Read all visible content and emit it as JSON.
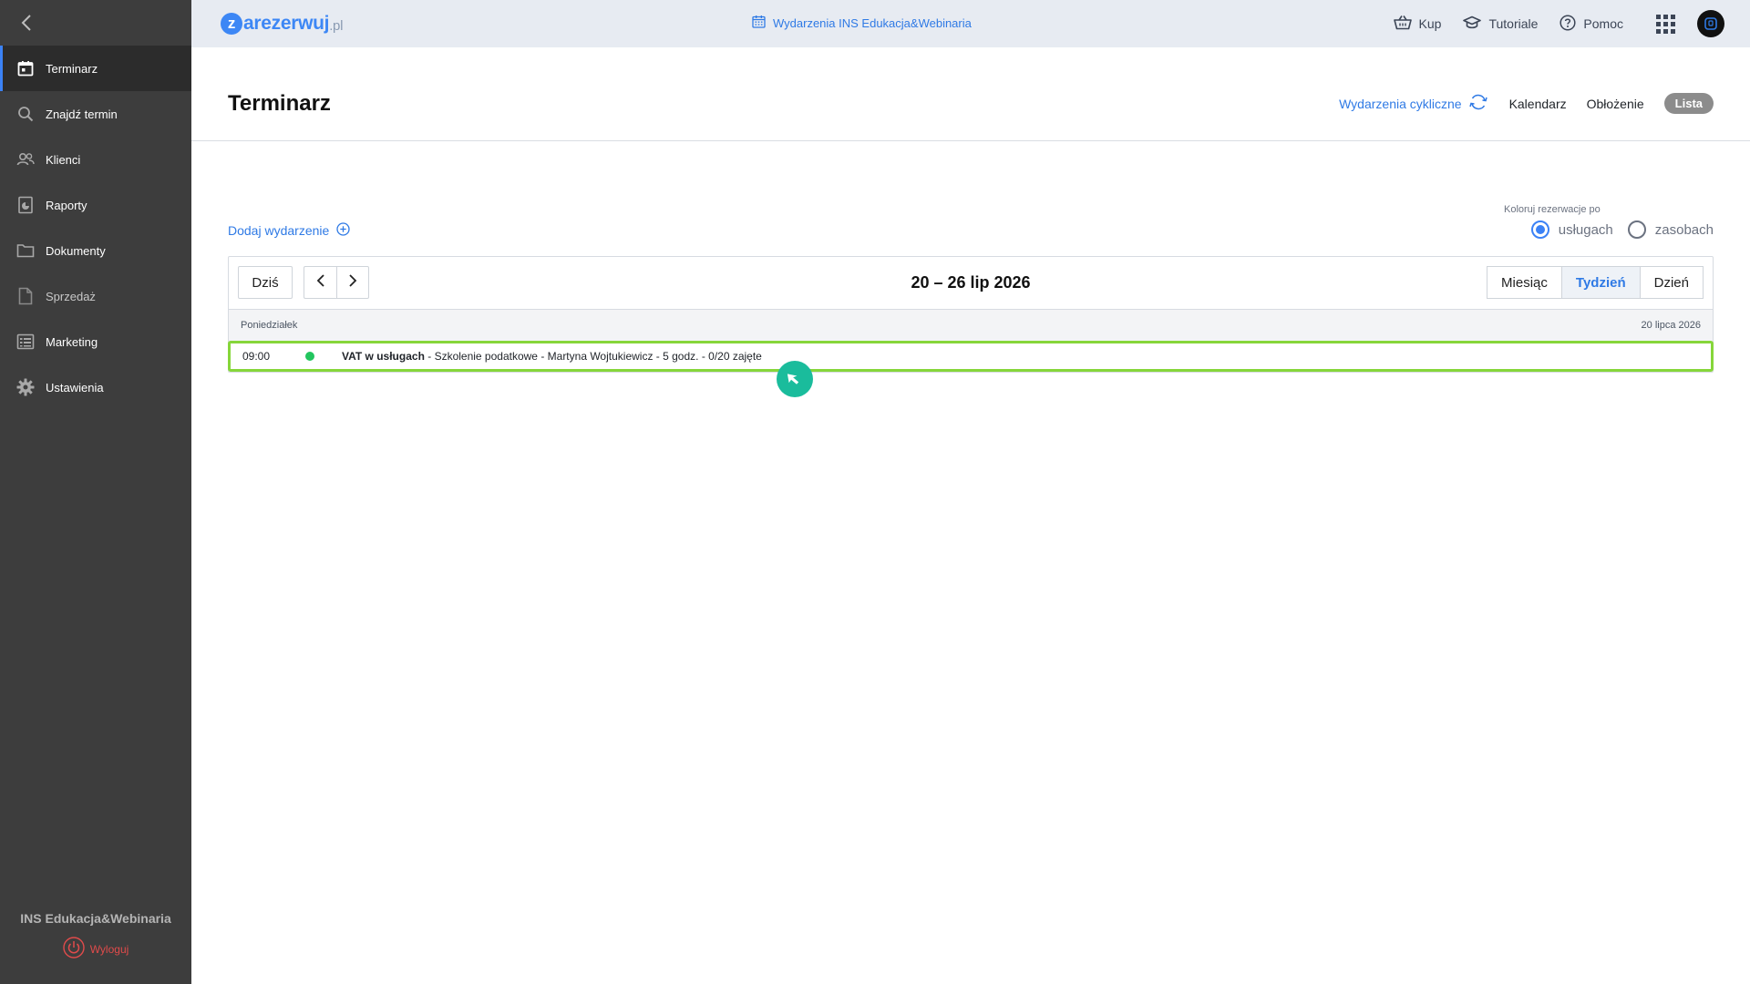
{
  "sidebar": {
    "items": [
      {
        "label": "Terminarz",
        "icon": "calendar-icon"
      },
      {
        "label": "Znajdź termin",
        "icon": "search-icon"
      },
      {
        "label": "Klienci",
        "icon": "users-icon"
      },
      {
        "label": "Raporty",
        "icon": "report-icon"
      },
      {
        "label": "Dokumenty",
        "icon": "folder-icon"
      },
      {
        "label": "Sprzedaż",
        "icon": "file-icon"
      },
      {
        "label": "Marketing",
        "icon": "list-icon"
      },
      {
        "label": "Ustawienia",
        "icon": "gear-icon"
      }
    ],
    "company": "INS Edukacja&Webinaria",
    "logout": "Wyloguj"
  },
  "topbar": {
    "logo_letter": "z",
    "logo_main": "arezerwuj",
    "logo_tld": ".pl",
    "center_title": "Wydarzenia INS Edukacja&Webinaria",
    "buy": "Kup",
    "tutorials": "Tutoriale",
    "help": "Pomoc"
  },
  "header": {
    "title": "Terminarz",
    "cyclic": "Wydarzenia cykliczne",
    "views": [
      "Kalendarz",
      "Obłożenie",
      "Lista"
    ]
  },
  "content": {
    "add_event": "Dodaj wydarzenie",
    "color_by_label": "Koloruj rezerwacje po",
    "color_by_options": [
      "usługach",
      "zasobach"
    ],
    "color_by_selected": "usługach"
  },
  "calendar": {
    "today": "Dziś",
    "range": "20 – 26 lip 2026",
    "view_buttons": [
      "Miesiąc",
      "Tydzień",
      "Dzień"
    ],
    "active_view": "Tydzień",
    "day": {
      "weekday": "Poniedziałek",
      "date": "20 lipca 2026"
    },
    "events": [
      {
        "time": "09:00",
        "title": "VAT w usługach",
        "details": " - Szkolenie podatkowe - Martyna Wojtukiewicz - 5 godz. - 0/20 zajęte",
        "status_color": "#22c55e"
      }
    ]
  },
  "colors": {
    "accent": "#2f7ae5",
    "sidebar_bg": "#3d3d3d",
    "highlight": "#86d63a",
    "cursor": "#1abc9c"
  }
}
